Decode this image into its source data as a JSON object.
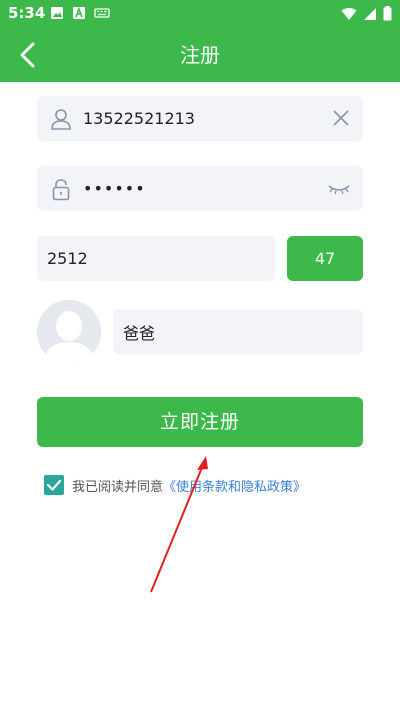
{
  "status_bar": {
    "time": "5:34"
  },
  "app_bar": {
    "title": "注册"
  },
  "form": {
    "phone": {
      "value": "13522521213"
    },
    "password": {
      "value": "••••••"
    },
    "verification_code": {
      "value": "2512"
    },
    "countdown": "47",
    "nickname": {
      "value": "爸爸"
    }
  },
  "register_button": {
    "label": "立即注册"
  },
  "agreement": {
    "text": "我已阅读并同意",
    "link": "《使用条款和隐私政策》",
    "checked": true
  },
  "colors": {
    "primary": "#3db84a",
    "field_bg": "#f3f4f8",
    "link": "#3b7fd6",
    "checkbox": "#2aa69a"
  }
}
